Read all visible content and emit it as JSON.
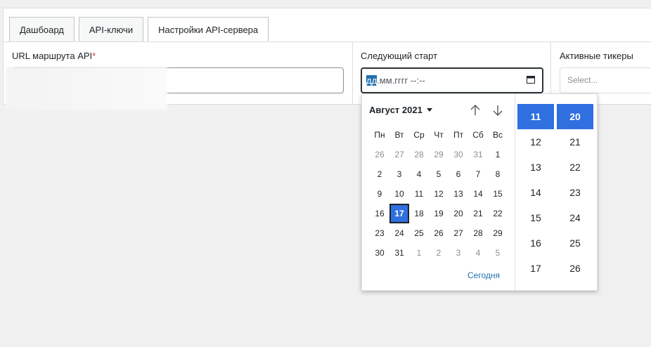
{
  "tabs": [
    {
      "label": "Дашбоард"
    },
    {
      "label": "API-ключи"
    },
    {
      "label": "Настройки API-сервера"
    }
  ],
  "form": {
    "route_url_label": "URL маршрута API",
    "route_url_required": "*",
    "next_start_label": "Следующий старт",
    "next_start_value_selected": "дд",
    "next_start_value_rest": ".мм.гггг  --:--",
    "active_tickers_label": "Активные тикеры",
    "active_tickers_placeholder": "Select..."
  },
  "picker": {
    "month_label": "Август 2021",
    "today_label": "Сегодня",
    "weekdays": [
      "Пн",
      "Вт",
      "Ср",
      "Чт",
      "Пт",
      "Сб",
      "Вс"
    ],
    "weeks": [
      [
        "26",
        "27",
        "28",
        "29",
        "30",
        "31",
        "1"
      ],
      [
        "2",
        "3",
        "4",
        "5",
        "6",
        "7",
        "8"
      ],
      [
        "9",
        "10",
        "11",
        "12",
        "13",
        "14",
        "15"
      ],
      [
        "16",
        "17",
        "18",
        "19",
        "20",
        "21",
        "22"
      ],
      [
        "23",
        "24",
        "25",
        "26",
        "27",
        "28",
        "29"
      ],
      [
        "30",
        "31",
        "1",
        "2",
        "3",
        "4",
        "5"
      ]
    ],
    "selected_day": "17",
    "hours": [
      "11",
      "12",
      "13",
      "14",
      "15",
      "16",
      "17"
    ],
    "minutes": [
      "20",
      "21",
      "22",
      "23",
      "24",
      "25",
      "26"
    ],
    "selected_hour": "11",
    "selected_minute": "20"
  },
  "colors": {
    "accent": "#2f6fe0",
    "link": "#2271b1",
    "required": "#d63638"
  }
}
